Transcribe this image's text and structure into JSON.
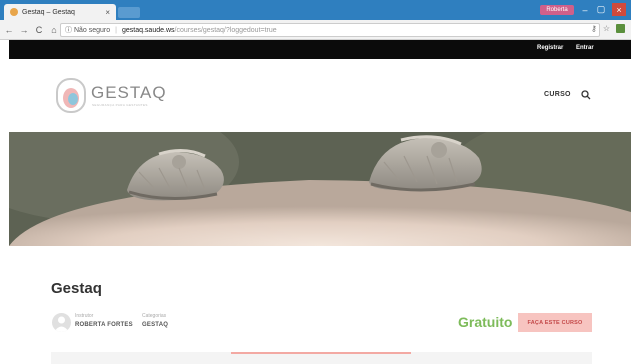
{
  "browser": {
    "tab_title": "Gestaq – Gestaq",
    "tab_close": "×",
    "profile_name": "Roberta",
    "window_minimize": "–",
    "window_maximize": "▢",
    "window_close": "×",
    "nav_back": "←",
    "nav_forward": "→",
    "nav_reload": "C",
    "nav_home": "⌂",
    "security_label": "ⓘ Não seguro",
    "url_host": "gestaq.saude.ws",
    "url_path": "/courses/gestaq/?loggedout=true",
    "key_icon": "⚷",
    "star_icon": "☆"
  },
  "topbar": {
    "register_label": "Registrar",
    "login_label": "Entrar"
  },
  "header": {
    "logo_text": "GESTAQ",
    "logo_tagline": "SEGURANÇA PARA GESTANTES",
    "nav_curso": "CURSO"
  },
  "course": {
    "title": "Gestaq",
    "instructor_label": "Instrutor",
    "instructor_name": "ROBERTA FORTES",
    "category_label": "Categorias",
    "category_value": "GESTAQ",
    "price": "Gratuito",
    "cta_label": "FAÇA ESTE CURSO"
  },
  "colors": {
    "brand_pink": "#f7c4c0",
    "price_green": "#7dbb5a",
    "chrome_blue": "#2f7fbf"
  }
}
